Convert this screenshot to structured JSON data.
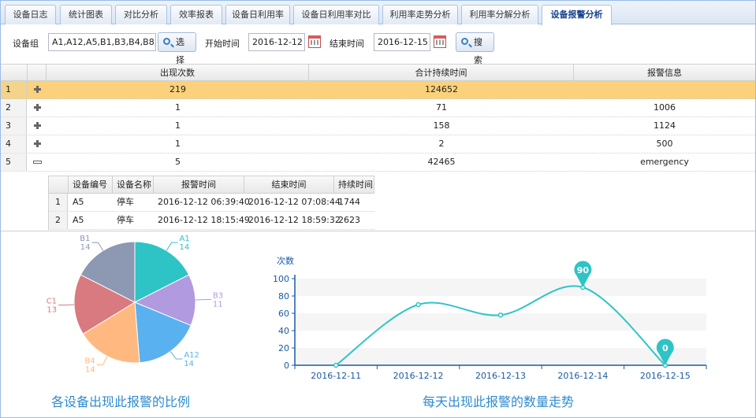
{
  "tabs": [
    {
      "label": "设备日志",
      "active": false
    },
    {
      "label": "统计图表",
      "active": false
    },
    {
      "label": "对比分析",
      "active": false
    },
    {
      "label": "效率报表",
      "active": false
    },
    {
      "label": "设备日利用率",
      "active": false
    },
    {
      "label": "设备日利用率对比",
      "active": false
    },
    {
      "label": "利用率走势分析",
      "active": false
    },
    {
      "label": "利用率分解分析",
      "active": false
    },
    {
      "label": "设备报警分析",
      "active": true
    }
  ],
  "toolbar": {
    "group_label": "设备组",
    "group_value": "A1,A12,A5,B1,B3,B4,B8,C",
    "select_label": "选择",
    "start_label": "开始时间",
    "start_value": "2016-12-12",
    "end_label": "结束时间",
    "end_value": "2016-12-15",
    "search_label": "搜索"
  },
  "grid": {
    "columns": [
      "出现次数",
      "合计持续时间",
      "报警信息"
    ],
    "rows": [
      {
        "n": "1",
        "count": "219",
        "duration": "124652",
        "info": "",
        "expanded": false,
        "selected": true
      },
      {
        "n": "2",
        "count": "1",
        "duration": "71",
        "info": "1006",
        "expanded": false,
        "selected": false
      },
      {
        "n": "3",
        "count": "1",
        "duration": "158",
        "info": "1124",
        "expanded": false,
        "selected": false
      },
      {
        "n": "4",
        "count": "1",
        "duration": "2",
        "info": "500",
        "expanded": false,
        "selected": false
      },
      {
        "n": "5",
        "count": "5",
        "duration": "42465",
        "info": "emergency",
        "expanded": true,
        "selected": false
      }
    ]
  },
  "subgrid": {
    "columns": [
      "设备编号",
      "设备名称",
      "报警时间",
      "结束时间",
      "持续时间"
    ],
    "rows": [
      {
        "n": "1",
        "id": "A5",
        "name": "停车",
        "start": "2016-12-12 06:39:40",
        "end": "2016-12-12 07:08:44",
        "dur": "1744"
      },
      {
        "n": "2",
        "id": "A5",
        "name": "停车",
        "start": "2016-12-12 18:15:49",
        "end": "2016-12-12 18:59:32",
        "dur": "2623"
      }
    ]
  },
  "chart_data": [
    {
      "type": "pie",
      "title": "各设备出现此报警的比例",
      "slices": [
        {
          "label": "A1",
          "value": 14,
          "color": "#2ec4c6"
        },
        {
          "label": "B3",
          "value": 11,
          "color": "#b19ae0"
        },
        {
          "label": "A12",
          "value": 14,
          "color": "#5ab1ef"
        },
        {
          "label": "B4",
          "value": 14,
          "color": "#ffb980"
        },
        {
          "label": "C1",
          "value": 13,
          "color": "#d87a80"
        },
        {
          "label": "B1",
          "value": 14,
          "color": "#8d98b3"
        }
      ]
    },
    {
      "type": "line",
      "title": "每天出现此报警的数量走势",
      "ylabel": "次数",
      "categories": [
        "2016-12-11",
        "2016-12-12",
        "2016-12-13",
        "2016-12-14",
        "2016-12-15"
      ],
      "values": [
        0,
        70,
        58,
        90,
        0
      ],
      "ylim": [
        0,
        100
      ],
      "yticks": [
        "0",
        "20",
        "40",
        "60",
        "80",
        "100"
      ],
      "markers": [
        {
          "label": "90"
        },
        {
          "label": "0"
        }
      ],
      "color": "#2ec4c6"
    }
  ]
}
